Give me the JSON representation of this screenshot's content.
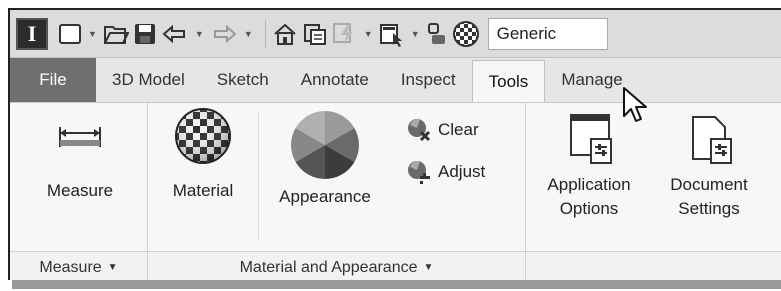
{
  "quick_access": {
    "app_letter": "I",
    "style_box": "Generic"
  },
  "tabs": [
    {
      "label": "File"
    },
    {
      "label": "3D Model"
    },
    {
      "label": "Sketch"
    },
    {
      "label": "Annotate"
    },
    {
      "label": "Inspect"
    },
    {
      "label": "Tools"
    },
    {
      "label": "Manage"
    }
  ],
  "ribbon": {
    "measure_panel": {
      "measure_label": "Measure",
      "panel_label": "Measure"
    },
    "material_panel": {
      "material_label": "Material",
      "appearance_label": "Appearance",
      "clear_label": "Clear",
      "adjust_label": "Adjust",
      "panel_label": "Material and Appearance"
    },
    "options_panel": {
      "app_options_line1": "Application",
      "app_options_line2": "Options",
      "doc_settings_line1": "Document",
      "doc_settings_line2": "Settings"
    }
  },
  "colors": {
    "file_tab_bg": "#6f6f6f",
    "ribbon_bg": "#f7f7f7"
  }
}
